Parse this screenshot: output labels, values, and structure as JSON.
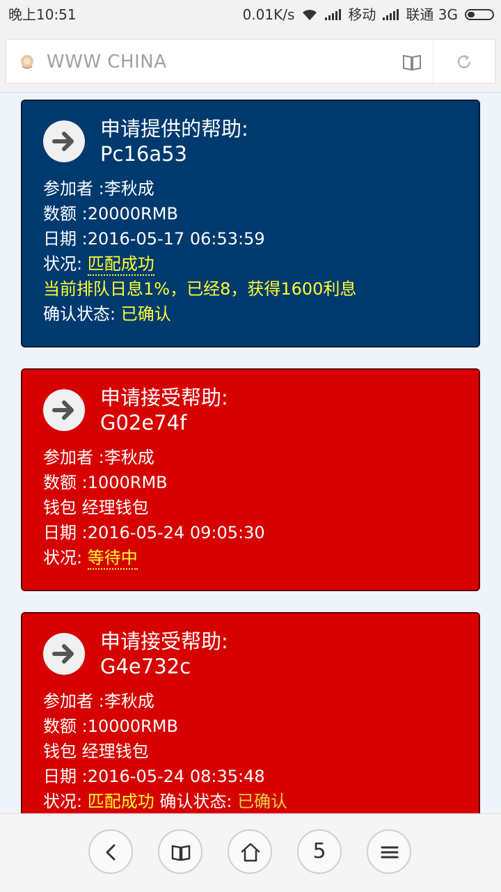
{
  "status_bar": {
    "time": "晚上10:51",
    "speed": "0.01K/s",
    "carrier1": "移动",
    "carrier2": "联通 3G"
  },
  "address_bar": {
    "url": "WWW CHINA"
  },
  "cards": [
    {
      "title": "申请提供的帮助:",
      "code": "Pc16a53",
      "participant": "参加者 :李秋成",
      "amount": "数额 :20000RMB",
      "date": "日期 :2016-05-17 06:53:59",
      "status_label": "状况: ",
      "status_value": "匹配成功",
      "interest_note": "当前排队日息1%，已经8，获得1600利息",
      "confirm_label": "确认状态: ",
      "confirm_value": "已确认",
      "color": "#013a6f"
    },
    {
      "title": "申请接受帮助:",
      "code": "G02e74f",
      "participant": "参加者 :李秋成",
      "amount": "数额 :1000RMB",
      "wallet": "钱包 经理钱包",
      "date": "日期 :2016-05-24 09:05:30",
      "status_label": "状况: ",
      "status_value": "等待中",
      "color": "#d60000"
    },
    {
      "title": "申请接受帮助:",
      "code": "G4e732c",
      "participant": "参加者 :李秋成",
      "amount": "数额 :10000RMB",
      "wallet": "钱包 经理钱包",
      "date": "日期 :2016-05-24 08:35:48",
      "status_label": "状况: ",
      "status_value": "匹配成功",
      "confirm_label": " 确认状态: ",
      "confirm_value": "已确认",
      "color": "#d60000"
    }
  ],
  "bottom_nav": {
    "tab_count": "5"
  },
  "icons": {
    "site": "shell-icon",
    "reader": "book-icon",
    "refresh": "refresh-icon",
    "card": "arrow-right-icon",
    "back": "back-icon",
    "bookmarks": "book-icon",
    "home": "home-icon",
    "menu": "menu-icon"
  }
}
